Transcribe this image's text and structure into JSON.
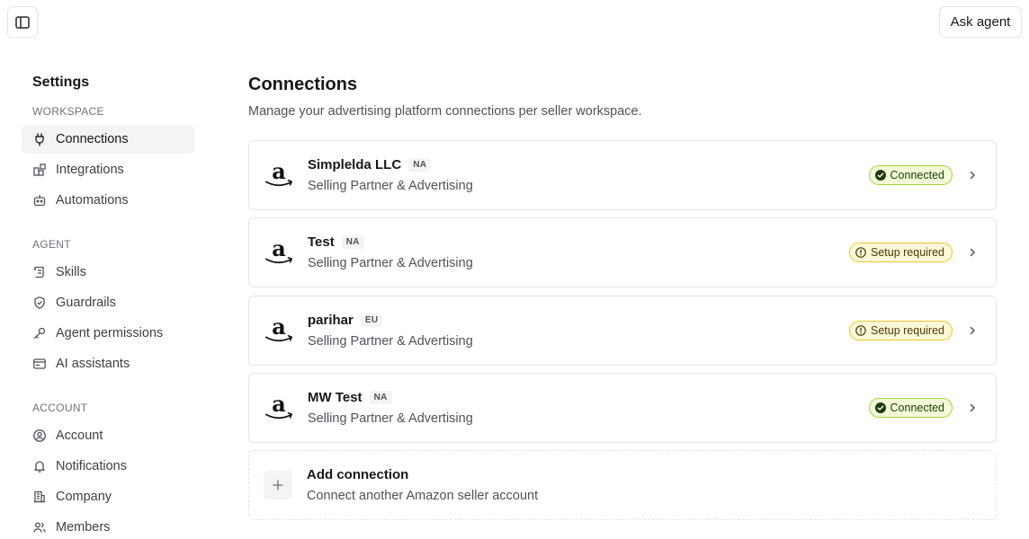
{
  "topbar": {
    "ask_agent_label": "Ask agent"
  },
  "sidebar": {
    "title": "Settings",
    "sections": {
      "workspace": "WORKSPACE",
      "agent": "AGENT",
      "account": "ACCOUNT"
    },
    "items": {
      "connections": "Connections",
      "integrations": "Integrations",
      "automations": "Automations",
      "skills": "Skills",
      "guardrails": "Guardrails",
      "agent_permissions": "Agent permissions",
      "ai_assistants": "AI assistants",
      "account": "Account",
      "notifications": "Notifications",
      "company": "Company",
      "members": "Members"
    },
    "icons": [
      "plug-icon",
      "integrations-icon",
      "robot-icon",
      "skills-scroll-icon",
      "shield-icon",
      "key-icon",
      "browser-window-icon",
      "user-circle-icon",
      "bell-icon",
      "building-icon",
      "users-icon"
    ]
  },
  "main": {
    "title": "Connections",
    "subtitle": "Manage your advertising platform connections per seller workspace.",
    "connections": [
      {
        "name": "Simplelda LLC",
        "region": "NA",
        "description": "Selling Partner & Advertising",
        "status": "Connected",
        "status_type": "connected"
      },
      {
        "name": "Test",
        "region": "NA",
        "description": "Selling Partner & Advertising",
        "status": "Setup required",
        "status_type": "setup"
      },
      {
        "name": "parihar",
        "region": "EU",
        "description": "Selling Partner & Advertising",
        "status": "Setup required",
        "status_type": "setup"
      },
      {
        "name": "MW Test",
        "region": "NA",
        "description": "Selling Partner & Advertising",
        "status": "Connected",
        "status_type": "connected"
      }
    ],
    "add_connection": {
      "title": "Add connection",
      "description": "Connect another Amazon seller account"
    }
  },
  "colors": {
    "connected_bg": "#f2fbd9",
    "connected_border": "#a3d433",
    "setup_bg": "#fdf8d8",
    "setup_border": "#e8c62c",
    "active_nav_bg": "#f4f4f5"
  }
}
